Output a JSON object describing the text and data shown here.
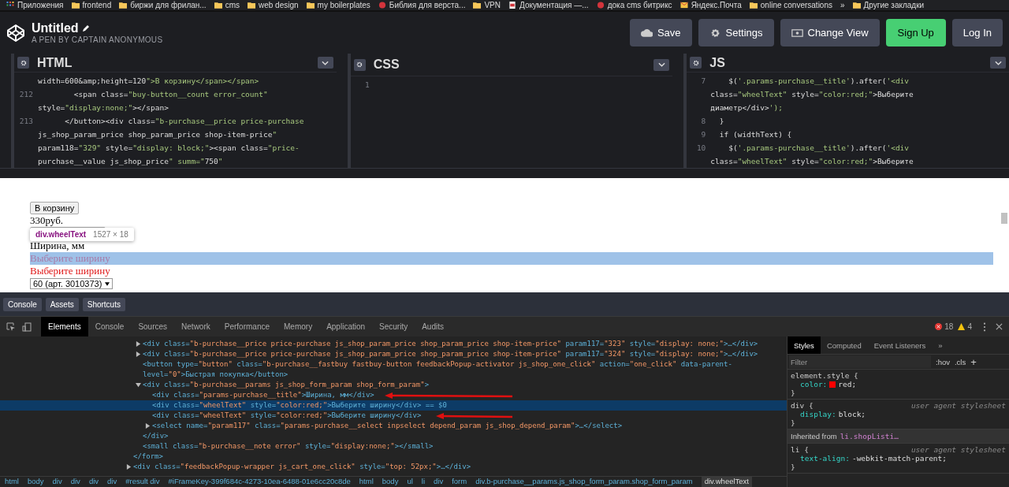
{
  "bookmarks": [
    {
      "kind": "apps",
      "label": "Приложения"
    },
    {
      "kind": "folder",
      "label": "frontend"
    },
    {
      "kind": "folder",
      "label": "биржи для фрилан..."
    },
    {
      "kind": "folder",
      "label": "cms"
    },
    {
      "kind": "folder",
      "label": "web design"
    },
    {
      "kind": "folder",
      "label": "my boilerplates"
    },
    {
      "kind": "site",
      "label": "Библия для верста..."
    },
    {
      "kind": "folder",
      "label": "VPN"
    },
    {
      "kind": "doc",
      "label": "Документация —..."
    },
    {
      "kind": "site",
      "label": "дока cms битрикс"
    },
    {
      "kind": "mail",
      "label": "Яндекс.Почта"
    },
    {
      "kind": "folder",
      "label": "online conversations"
    },
    {
      "kind": "more",
      "label": "»"
    },
    {
      "kind": "folder",
      "label": "Другие закладки"
    }
  ],
  "header": {
    "title": "Untitled",
    "subtitle": "A PEN BY CAPTAIN ANONYMOUS",
    "buttons": [
      {
        "kind": "save",
        "label": "Save"
      },
      {
        "kind": "settings",
        "label": "Settings"
      },
      {
        "kind": "view",
        "label": "Change View"
      },
      {
        "kind": "signup",
        "label": "Sign Up"
      },
      {
        "kind": "login",
        "label": "Log In"
      }
    ]
  },
  "editors": [
    {
      "title": "HTML",
      "lines": [
        {
          "text": "width=600&amp;height=120\">В корзину</span></span>"
        },
        {
          "n": "212",
          "text": "        <span class=\"buy-button__count error_count\""
        },
        {
          "text": "style=\"display:none;\"></span>"
        },
        {
          "n": "213",
          "text": "      </button><div class=\"b-purchase__price price-purchase"
        },
        {
          "text": "js_shop_param_price shop_param_price shop-item-price\""
        },
        {
          "text": "param118=\"329\" style=\"display: block;\"><span class=\"price-"
        },
        {
          "text": "purchase__value js_shop_price\" summ=\"750\""
        }
      ]
    },
    {
      "title": "CSS",
      "lines": [
        {
          "n": "1"
        }
      ]
    },
    {
      "title": "JS",
      "lines": [
        {
          "n": "7",
          "text": "    $('.params-purchase__title').after('<div"
        },
        {
          "text": "class=\"wheelText\" style=\"color:red;\">Выберите"
        },
        {
          "text": "диаметр</div>');"
        },
        {
          "n": "8",
          "text": "  }"
        },
        {
          "n": "9",
          "text": "  if (widthText) {"
        },
        {
          "n": "10",
          "text": "    $('.params-purchase__title').after('<div"
        },
        {
          "text": "class=\"wheelText\" style=\"color:red;\">Выберите"
        }
      ]
    }
  ],
  "preview": {
    "items": [
      {
        "kind": "button",
        "text": "В корзину",
        "highlighted": false
      },
      {
        "kind": "text",
        "text": "330руб.",
        "highlighted": false
      },
      {
        "kind": "blank-button",
        "highlighted": false
      },
      {
        "kind": "text",
        "text": "Ширина, мм",
        "highlighted": false
      },
      {
        "kind": "warning",
        "text": "Выберите ширину",
        "highlighted": true
      },
      {
        "kind": "warning",
        "text": "Выберите ширину",
        "highlighted": false
      },
      {
        "kind": "select",
        "text": "60 (арт. 3010373)",
        "highlighted": false
      }
    ],
    "tooltip": {
      "element": "div.wheelText",
      "size": "1527 × 18"
    }
  },
  "pen_bar": [
    "Console",
    "Assets",
    "Shortcuts"
  ],
  "devtools": {
    "tabs": [
      {
        "label": "Elements",
        "selected": true
      },
      {
        "label": "Console",
        "selected": false
      },
      {
        "label": "Sources",
        "selected": false
      },
      {
        "label": "Network",
        "selected": false
      },
      {
        "label": "Performance",
        "selected": false
      },
      {
        "label": "Memory",
        "selected": false
      },
      {
        "label": "Application",
        "selected": false
      },
      {
        "label": "Security",
        "selected": false
      },
      {
        "label": "Audits",
        "selected": false
      }
    ],
    "errors": "18",
    "warnings": "4",
    "dom": [
      {
        "closing": "</form>",
        "children": [
          {
            "text": "<div class=\"b-purchase__price price-purchase js_shop_param_price shop_param_price shop-item-price\" param117=\"323\" style=\"display: none;\">…</div>",
            "expanded": false,
            "selected": false
          },
          {
            "text": "<div class=\"b-purchase__price price-purchase js_shop_param_price shop_param_price shop-item-price\" param117=\"324\" style=\"display: none;\">…</div>",
            "expanded": false,
            "selected": false
          },
          {
            "text": "<button type=\"button\" class=\"b-purchase__fastbuy fastbuy-button feedbackPopup-activator js_shop_one_click\" action=\"one_click\" data-parent-level=\"0\">Быстрая покупка</button>",
            "selected": false
          },
          {
            "text": "<div class=\"b-purchase__params js_shop_form_param shop_form_param\">",
            "expanded": true,
            "selected": false,
            "closing": "</div>",
            "children": [
              {
                "text": "<div class=\"params-purchase__title\">Ширина, мм</div>",
                "selected": false
              },
              {
                "text": "<div class=\"wheelText\" style=\"color:red;\">Выберите ширину</div> == $0",
                "selected": true
              },
              {
                "text": "<div class=\"wheelText\" style=\"color:red;\">Выберите ширину</div>",
                "selected": false
              },
              {
                "text": "<select name=\"param117\" class=\"params-purchase__select inpselect depend_param js_shop_depend_param\">…</select>",
                "expanded": false,
                "selected": false
              }
            ]
          },
          {
            "text": "<small class=\"b-purchase__note error\" style=\"display:none;\"></small>",
            "selected": false
          }
        ]
      },
      {
        "text": "<div class=\"feedbackPopup-wrapper js_cart_one_click\" style=\"top: 52px;\">…</div>",
        "expanded": false,
        "selected": false
      }
    ],
    "breadcrumbs": [
      {
        "label": "html",
        "selected": false
      },
      {
        "label": "body",
        "selected": false
      },
      {
        "label": "div",
        "selected": false
      },
      {
        "label": "div",
        "selected": false
      },
      {
        "label": "div",
        "selected": false
      },
      {
        "label": "div",
        "selected": false
      },
      {
        "label": "#result div",
        "selected": false
      },
      {
        "label": "#iFrameKey-399f684c-4273-10ea-6488-01e6cc20c8de",
        "selected": false
      },
      {
        "label": "html",
        "selected": false
      },
      {
        "label": "body",
        "selected": false
      },
      {
        "label": "ul",
        "selected": false
      },
      {
        "label": "li",
        "selected": false
      },
      {
        "label": "div",
        "selected": false
      },
      {
        "label": "form",
        "selected": false
      },
      {
        "label": "div.b-purchase__params.js_shop_form_param.shop_form_param",
        "selected": false
      },
      {
        "label": "div.wheelText",
        "selected": true
      }
    ],
    "styles": {
      "tabs": [
        {
          "label": "Styles",
          "selected": true
        },
        {
          "label": "Computed",
          "selected": false
        },
        {
          "label": "Event Listeners",
          "selected": false
        },
        {
          "label": "»",
          "selected": false
        }
      ],
      "filter_placeholder": "Filter",
      "hov": ":hov",
      "cls": ".cls",
      "add": "+",
      "blocks": [
        {
          "kind": "rule",
          "selector": "element.style",
          "open": "{",
          "close": "}",
          "props": [
            {
              "name": "color:",
              "value": "red;",
              "swatch": true
            }
          ]
        },
        {
          "kind": "rule",
          "selector": "div",
          "open": "{",
          "close": "}",
          "source": "user agent stylesheet",
          "props": [
            {
              "name": "display:",
              "value": "block;"
            }
          ]
        },
        {
          "kind": "inherited",
          "label": "Inherited from",
          "target": "li.shopListi…"
        },
        {
          "kind": "rule",
          "selector": "li",
          "open": "{",
          "close": "}",
          "source": "user agent stylesheet",
          "props": [
            {
              "name": "text-align:",
              "value": "-webkit-match-parent;"
            }
          ]
        }
      ]
    }
  }
}
